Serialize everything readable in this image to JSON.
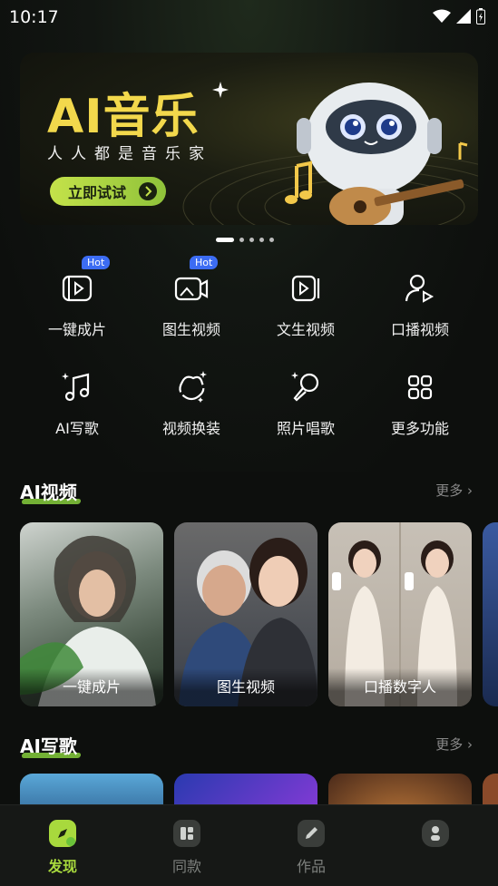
{
  "status": {
    "time": "10:17"
  },
  "banner": {
    "title": "AI音乐",
    "subtitle": "人人都是音乐家",
    "button": "立即试试"
  },
  "features": [
    {
      "label": "一键成片",
      "badge": "Hot",
      "icon": "film-play-icon"
    },
    {
      "label": "图生视频",
      "badge": "Hot",
      "icon": "image-video-icon"
    },
    {
      "label": "文生视频",
      "badge": "",
      "icon": "text-video-icon"
    },
    {
      "label": "口播视频",
      "badge": "",
      "icon": "person-play-icon"
    },
    {
      "label": "AI写歌",
      "badge": "",
      "icon": "music-sparkle-icon"
    },
    {
      "label": "视频换装",
      "badge": "",
      "icon": "outfit-sparkle-icon"
    },
    {
      "label": "照片唱歌",
      "badge": "",
      "icon": "mic-sparkle-icon"
    },
    {
      "label": "更多功能",
      "badge": "",
      "icon": "grid-icon"
    }
  ],
  "ai_video": {
    "title": "AI视频",
    "more": "更多",
    "cards": [
      "一键成片",
      "图生视频",
      "口播数字人"
    ]
  },
  "ai_song": {
    "title": "AI写歌",
    "more": "更多"
  },
  "nav": [
    {
      "label": "发现",
      "active": true
    },
    {
      "label": "同款",
      "active": false
    },
    {
      "label": "作品",
      "active": false
    },
    {
      "label": "",
      "active": false
    }
  ],
  "colors": {
    "accent": "#a8d93d",
    "hot_badge": "#3c6cf3",
    "banner_title": "#f2d84c"
  }
}
